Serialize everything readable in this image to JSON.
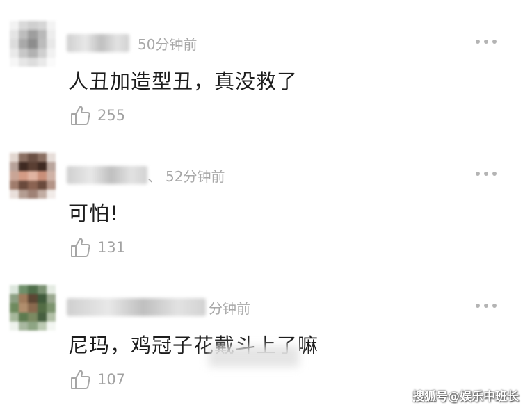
{
  "comments": [
    {
      "time": "50分钟前",
      "text": "人丑加造型丑，真没救了",
      "likes": "255",
      "name_blur_width": 90,
      "avatar_colors": [
        "#f2f2f2",
        "#d9d9d9",
        "#cfcfcf",
        "#d6d6d6",
        "#f3f3f3",
        "#e4e4e4",
        "#bdbdbd",
        "#9e9e9e",
        "#b9b9b9",
        "#ededed",
        "#dcdcdc",
        "#a9a9a9",
        "#8d8d8d",
        "#bcbcbc",
        "#e8e8e8",
        "#e9e9e9",
        "#c7c7c7",
        "#b2b2b2",
        "#cfcfcf",
        "#f1f1f1",
        "#f6f6f6",
        "#e6e6e6",
        "#dddddd",
        "#e9e9e9",
        "#fafafa"
      ]
    },
    {
      "time": "52分钟前",
      "text": "可怕!",
      "likes": "131",
      "name_blur_width": 116,
      "name_suffix": "、",
      "avatar_colors": [
        "#e2d6cf",
        "#8a6f62",
        "#6b5044",
        "#8a6f62",
        "#e6ddd8",
        "#b7a299",
        "#3f2a22",
        "#5a3f33",
        "#3f2a22",
        "#b9a59c",
        "#c9a596",
        "#d39b85",
        "#e0b3a1",
        "#c98f79",
        "#cfb2a6",
        "#a07c6c",
        "#6a4a3c",
        "#8b6352",
        "#6a4a3c",
        "#b39487",
        "#e9dfda",
        "#b49d92",
        "#9f8276",
        "#c2ada3",
        "#f1ebe8"
      ]
    },
    {
      "time": "分钟前",
      "text": "尼玛，鸡冠子花戴斗上了嘛",
      "likes": "107",
      "name_blur_width": 200,
      "avatar_colors": [
        "#dce6dc",
        "#6f8f6a",
        "#4f6e4a",
        "#7a9172",
        "#e4ebe2",
        "#8c9f82",
        "#a07b5c",
        "#5c4634",
        "#3f5a3b",
        "#9aa88f",
        "#6e8a5e",
        "#b18e6d",
        "#8a6a4f",
        "#536d45",
        "#7d946f",
        "#a6b79b",
        "#5d7a4f",
        "#7b8a62",
        "#465f3f",
        "#b2c0a7",
        "#eef2ec",
        "#a8b8a0",
        "#8ea584",
        "#bccab3",
        "#f3f6f2"
      ]
    }
  ],
  "watermark": "搜狐号@娱乐中班长",
  "colors": {
    "text": "#1d1d1d",
    "meta": "#a8a8a8",
    "divider": "#e6e6e6",
    "icon": "#a6a6a6"
  },
  "icons": {
    "like": "thumbs-up-icon",
    "more": "more-dots-icon"
  }
}
